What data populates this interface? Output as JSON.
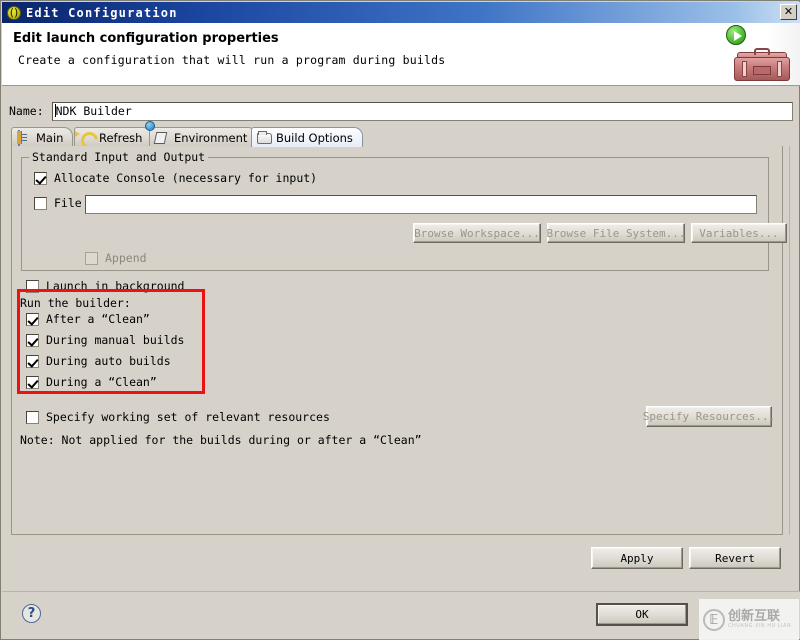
{
  "window": {
    "title": "Edit Configuration",
    "icon": "config-ball-icon",
    "close_label": "✕"
  },
  "header": {
    "title": "Edit launch configuration properties",
    "subtitle": "Create a configuration that will run a program during builds",
    "art_icon": "toolbox-with-play-icon"
  },
  "name_field": {
    "label": "Name:",
    "value": "NDK Builder"
  },
  "tabs": [
    {
      "label": "Main",
      "icon": "document-icon",
      "selected": false
    },
    {
      "label": "Refresh",
      "icon": "refresh-icon",
      "selected": false
    },
    {
      "label": "Environment",
      "icon": "environment-icon",
      "selected": false
    },
    {
      "label": "Build Options",
      "icon": "folder-open-icon",
      "selected": true
    }
  ],
  "standard_io": {
    "group_title": "Standard Input and Output",
    "allocate_console": {
      "label": "Allocate Console (necessary for input)",
      "checked": true,
      "enabled": true
    },
    "file": {
      "label": "File",
      "checked": false,
      "enabled": true,
      "value": "",
      "placeholder": ""
    },
    "append": {
      "label": "Append",
      "checked": false,
      "enabled": false
    },
    "buttons": [
      {
        "label": "Browse Workspace...",
        "enabled": false
      },
      {
        "label": "Browse File System...",
        "enabled": false
      },
      {
        "label": "Variables...",
        "enabled": false
      }
    ]
  },
  "launch_in_background": {
    "label": "Launch in background",
    "checked": false
  },
  "run_the_builder": {
    "title": "Run the builder:",
    "highlighted": true,
    "highlight_color": "#ee1111",
    "options": [
      {
        "label": "After a “Clean”",
        "checked": true
      },
      {
        "label": "During manual builds",
        "checked": true
      },
      {
        "label": "During auto builds",
        "checked": true
      },
      {
        "label": "During a “Clean”",
        "checked": true
      }
    ]
  },
  "working_set": {
    "label": "Specify working set of relevant resources",
    "checked": false,
    "button_label": "Specify Resources...",
    "button_enabled": false
  },
  "note": "Note: Not applied for the builds during or after a “Clean”",
  "action_buttons": {
    "apply": "Apply",
    "revert": "Revert",
    "ok": "OK"
  },
  "footer": {
    "help_icon": "question-mark-icon",
    "help_label": "?"
  },
  "watermark": {
    "logo": "cx-circle-logo",
    "text": "创新互联",
    "subtext": "CHUANG XIN HU LIAN"
  }
}
